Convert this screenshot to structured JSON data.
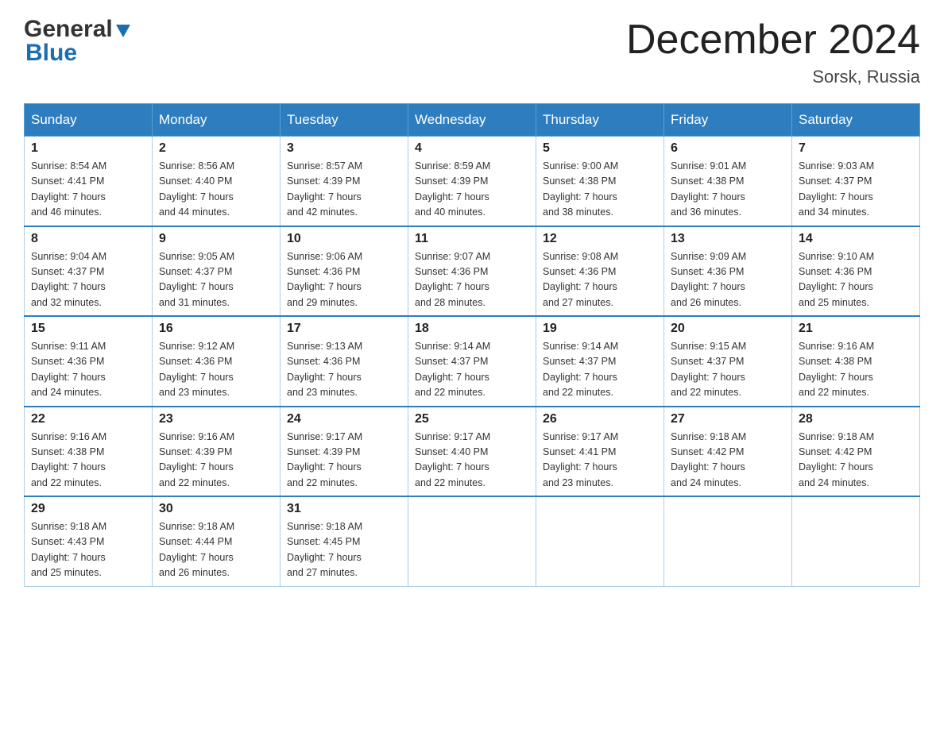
{
  "header": {
    "logo_general": "General",
    "logo_blue": "Blue",
    "month_title": "December 2024",
    "location": "Sorsk, Russia"
  },
  "weekdays": [
    "Sunday",
    "Monday",
    "Tuesday",
    "Wednesday",
    "Thursday",
    "Friday",
    "Saturday"
  ],
  "weeks": [
    [
      {
        "day": "1",
        "info": "Sunrise: 8:54 AM\nSunset: 4:41 PM\nDaylight: 7 hours\nand 46 minutes."
      },
      {
        "day": "2",
        "info": "Sunrise: 8:56 AM\nSunset: 4:40 PM\nDaylight: 7 hours\nand 44 minutes."
      },
      {
        "day": "3",
        "info": "Sunrise: 8:57 AM\nSunset: 4:39 PM\nDaylight: 7 hours\nand 42 minutes."
      },
      {
        "day": "4",
        "info": "Sunrise: 8:59 AM\nSunset: 4:39 PM\nDaylight: 7 hours\nand 40 minutes."
      },
      {
        "day": "5",
        "info": "Sunrise: 9:00 AM\nSunset: 4:38 PM\nDaylight: 7 hours\nand 38 minutes."
      },
      {
        "day": "6",
        "info": "Sunrise: 9:01 AM\nSunset: 4:38 PM\nDaylight: 7 hours\nand 36 minutes."
      },
      {
        "day": "7",
        "info": "Sunrise: 9:03 AM\nSunset: 4:37 PM\nDaylight: 7 hours\nand 34 minutes."
      }
    ],
    [
      {
        "day": "8",
        "info": "Sunrise: 9:04 AM\nSunset: 4:37 PM\nDaylight: 7 hours\nand 32 minutes."
      },
      {
        "day": "9",
        "info": "Sunrise: 9:05 AM\nSunset: 4:37 PM\nDaylight: 7 hours\nand 31 minutes."
      },
      {
        "day": "10",
        "info": "Sunrise: 9:06 AM\nSunset: 4:36 PM\nDaylight: 7 hours\nand 29 minutes."
      },
      {
        "day": "11",
        "info": "Sunrise: 9:07 AM\nSunset: 4:36 PM\nDaylight: 7 hours\nand 28 minutes."
      },
      {
        "day": "12",
        "info": "Sunrise: 9:08 AM\nSunset: 4:36 PM\nDaylight: 7 hours\nand 27 minutes."
      },
      {
        "day": "13",
        "info": "Sunrise: 9:09 AM\nSunset: 4:36 PM\nDaylight: 7 hours\nand 26 minutes."
      },
      {
        "day": "14",
        "info": "Sunrise: 9:10 AM\nSunset: 4:36 PM\nDaylight: 7 hours\nand 25 minutes."
      }
    ],
    [
      {
        "day": "15",
        "info": "Sunrise: 9:11 AM\nSunset: 4:36 PM\nDaylight: 7 hours\nand 24 minutes."
      },
      {
        "day": "16",
        "info": "Sunrise: 9:12 AM\nSunset: 4:36 PM\nDaylight: 7 hours\nand 23 minutes."
      },
      {
        "day": "17",
        "info": "Sunrise: 9:13 AM\nSunset: 4:36 PM\nDaylight: 7 hours\nand 23 minutes."
      },
      {
        "day": "18",
        "info": "Sunrise: 9:14 AM\nSunset: 4:37 PM\nDaylight: 7 hours\nand 22 minutes."
      },
      {
        "day": "19",
        "info": "Sunrise: 9:14 AM\nSunset: 4:37 PM\nDaylight: 7 hours\nand 22 minutes."
      },
      {
        "day": "20",
        "info": "Sunrise: 9:15 AM\nSunset: 4:37 PM\nDaylight: 7 hours\nand 22 minutes."
      },
      {
        "day": "21",
        "info": "Sunrise: 9:16 AM\nSunset: 4:38 PM\nDaylight: 7 hours\nand 22 minutes."
      }
    ],
    [
      {
        "day": "22",
        "info": "Sunrise: 9:16 AM\nSunset: 4:38 PM\nDaylight: 7 hours\nand 22 minutes."
      },
      {
        "day": "23",
        "info": "Sunrise: 9:16 AM\nSunset: 4:39 PM\nDaylight: 7 hours\nand 22 minutes."
      },
      {
        "day": "24",
        "info": "Sunrise: 9:17 AM\nSunset: 4:39 PM\nDaylight: 7 hours\nand 22 minutes."
      },
      {
        "day": "25",
        "info": "Sunrise: 9:17 AM\nSunset: 4:40 PM\nDaylight: 7 hours\nand 22 minutes."
      },
      {
        "day": "26",
        "info": "Sunrise: 9:17 AM\nSunset: 4:41 PM\nDaylight: 7 hours\nand 23 minutes."
      },
      {
        "day": "27",
        "info": "Sunrise: 9:18 AM\nSunset: 4:42 PM\nDaylight: 7 hours\nand 24 minutes."
      },
      {
        "day": "28",
        "info": "Sunrise: 9:18 AM\nSunset: 4:42 PM\nDaylight: 7 hours\nand 24 minutes."
      }
    ],
    [
      {
        "day": "29",
        "info": "Sunrise: 9:18 AM\nSunset: 4:43 PM\nDaylight: 7 hours\nand 25 minutes."
      },
      {
        "day": "30",
        "info": "Sunrise: 9:18 AM\nSunset: 4:44 PM\nDaylight: 7 hours\nand 26 minutes."
      },
      {
        "day": "31",
        "info": "Sunrise: 9:18 AM\nSunset: 4:45 PM\nDaylight: 7 hours\nand 27 minutes."
      },
      {
        "day": "",
        "info": ""
      },
      {
        "day": "",
        "info": ""
      },
      {
        "day": "",
        "info": ""
      },
      {
        "day": "",
        "info": ""
      }
    ]
  ]
}
